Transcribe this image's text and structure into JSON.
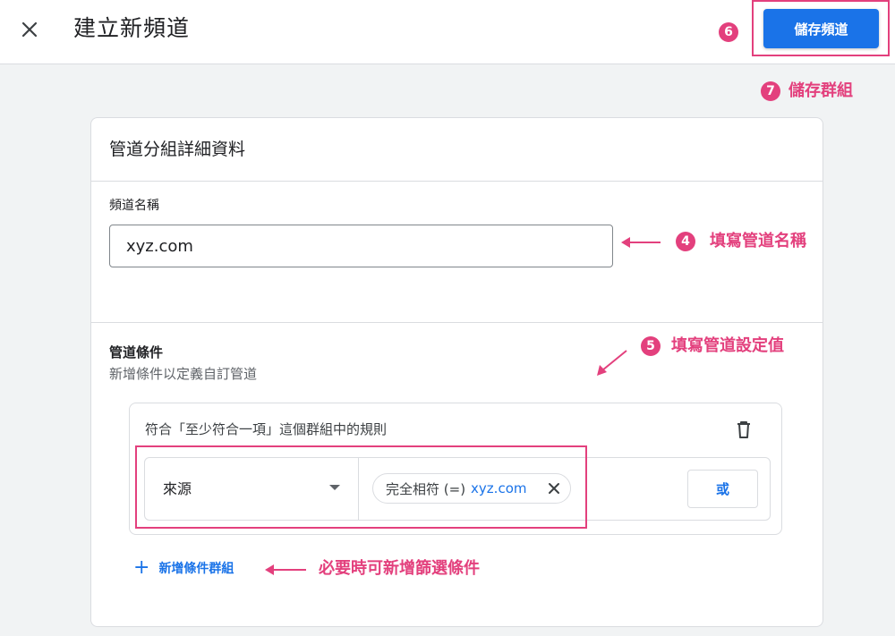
{
  "header": {
    "title": "建立新頻道",
    "save_label": "儲存頻道"
  },
  "card": {
    "title": "管道分組詳細資料",
    "name_field": {
      "label": "頻道名稱",
      "value": "xyz.com"
    },
    "conditions": {
      "title": "管道條件",
      "subtitle": "新增條件以定義自訂管道",
      "group_title": "符合「至少符合一項」這個群組中的規則",
      "source_select": "來源",
      "chip_operator": "完全相符 (=)",
      "chip_value": "xyz.com",
      "or_label": "或",
      "add_group_label": "新增條件群組",
      "add_group_icon": "+"
    }
  },
  "annotations": {
    "a4": {
      "num": "4",
      "text": "填寫管道名稱"
    },
    "a5": {
      "num": "5",
      "text": "填寫管道設定值"
    },
    "a6": {
      "num": "6"
    },
    "a7": {
      "num": "7",
      "text": "儲存群組"
    },
    "a_add": {
      "text": "必要時可新增篩選條件"
    },
    "color": "#e3407d"
  },
  "colors": {
    "accent": "#1a73e8",
    "annotation": "#e3407d"
  }
}
